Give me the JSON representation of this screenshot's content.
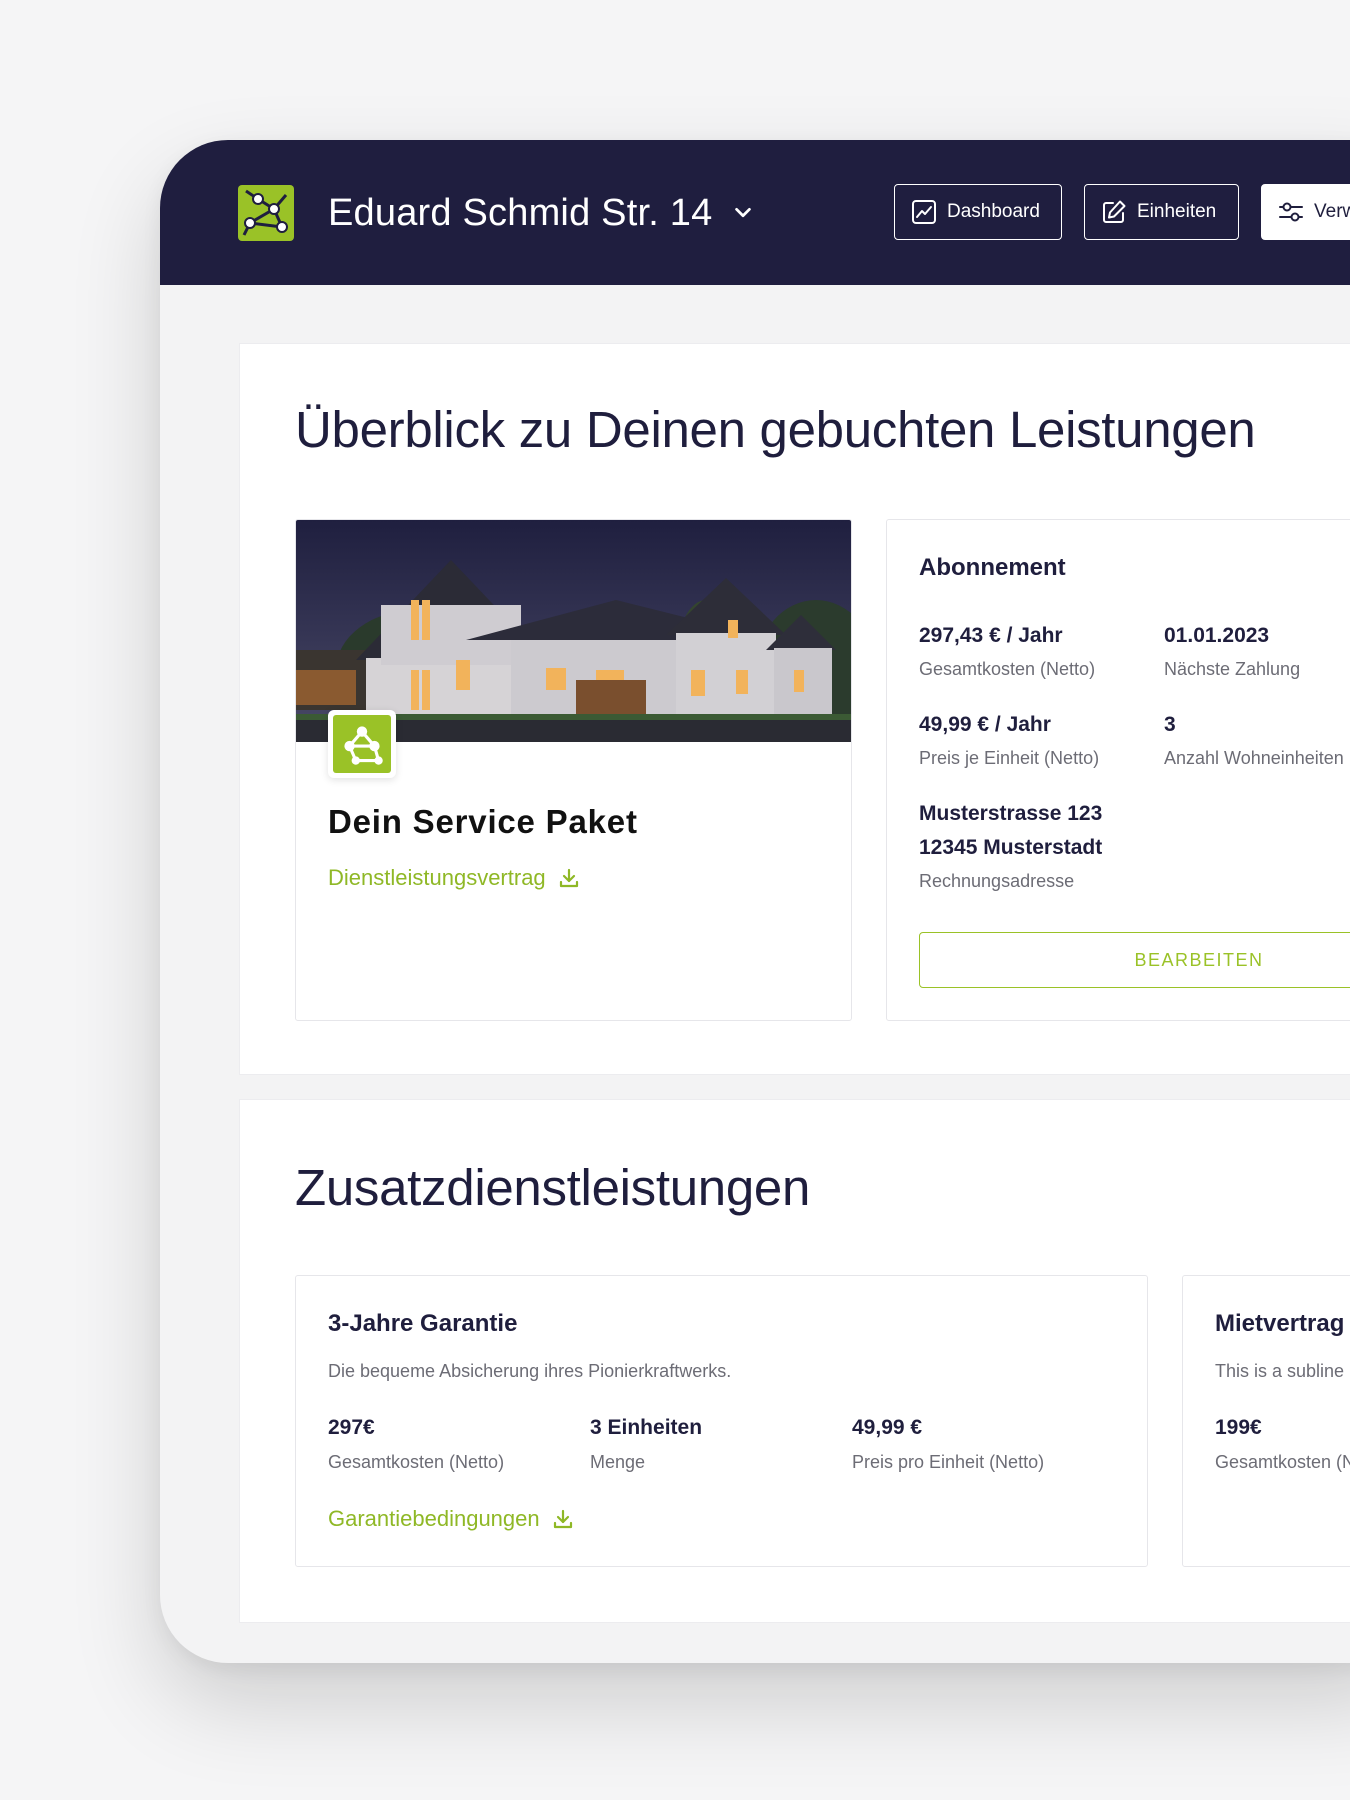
{
  "header": {
    "property_name": "Eduard Schmid Str. 14",
    "nav": {
      "dashboard": "Dashboard",
      "einheiten": "Einheiten",
      "verwaltung": "Verwaltung"
    }
  },
  "overview": {
    "title": "Überblick zu Deinen gebuchten Leistungen",
    "package": {
      "title": "Dein Service Paket",
      "contract_link": "Dienstleistungsvertrag"
    },
    "subscription": {
      "title": "Abonnement",
      "total_cost_value": "297,43 € / Jahr",
      "total_cost_label": "Gesamtkosten (Netto)",
      "next_payment_value": "01.01.2023",
      "next_payment_label": "Nächste Zahlung",
      "unit_price_value": "49,99 € / Jahr",
      "unit_price_label": "Preis je Einheit (Netto)",
      "units_value": "3",
      "units_label": "Anzahl Wohneinheiten",
      "address_line1": "Musterstrasse 123",
      "address_line2": "12345 Musterstadt",
      "address_label": "Rechnungsadresse",
      "edit_button": "BEARBEITEN"
    }
  },
  "extras": {
    "title": "Zusatzdienstleistungen",
    "services": [
      {
        "title": "3-Jahre Garantie",
        "subline": "Die bequeme Absicherung ihres Pionierkraftwerks.",
        "total_value": "297€",
        "total_label": "Gesamtkosten (Netto)",
        "quantity_value": "3 Einheiten",
        "quantity_label": "Menge",
        "unit_price_value": "49,99 €",
        "unit_price_label": "Preis pro Einheit (Netto)",
        "link": "Garantiebedingungen"
      },
      {
        "title": "Mietvertrag",
        "subline": "This is a subline",
        "total_value": "199€",
        "total_label": "Gesamtkosten (Netto)"
      }
    ]
  },
  "colors": {
    "navy": "#1f1e3f",
    "accent_green": "#9ac227",
    "link_green": "#8fb826",
    "muted_text": "#6c6c75"
  },
  "icons": [
    "network-logo-icon",
    "chevron-down-icon",
    "chart-icon",
    "edit-icon",
    "sliders-icon",
    "download-icon"
  ]
}
